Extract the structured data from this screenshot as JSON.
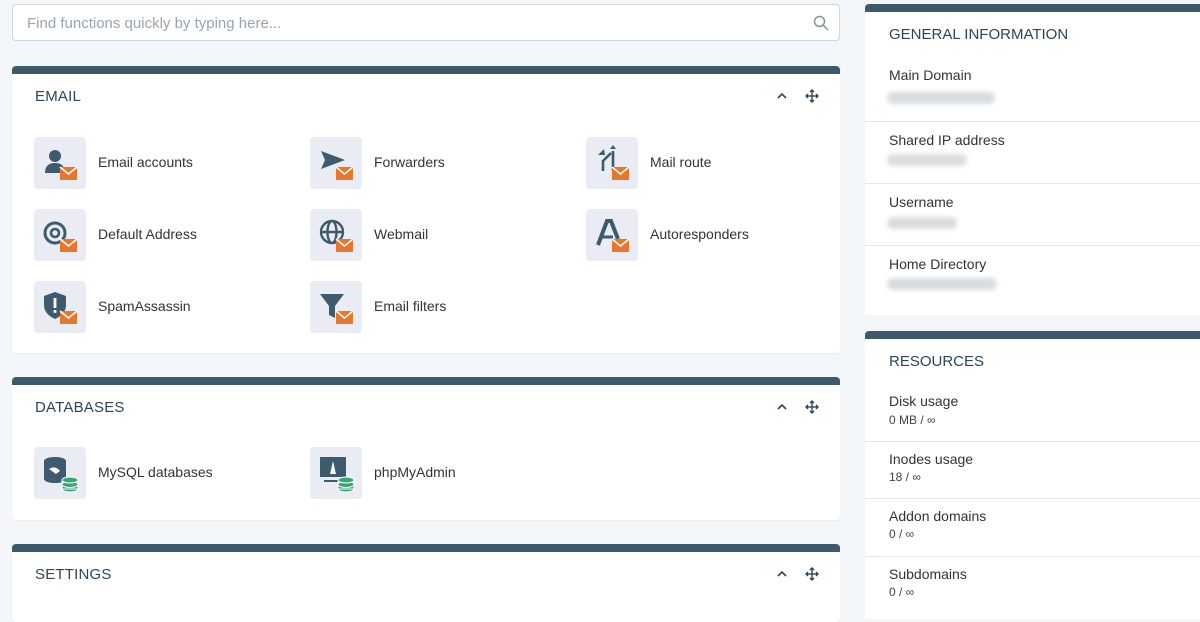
{
  "search": {
    "placeholder": "Find functions quickly by typing here..."
  },
  "colors": {
    "accent_bar": "#3d5a6c",
    "icon_dark": "#3e5a6e",
    "envelope_orange": "#e8772e",
    "db_green": "#3aa57a",
    "tile_bg": "#e9ecf3"
  },
  "email": {
    "title": "EMAIL",
    "items": [
      {
        "label": "Email accounts",
        "icon": "user-icon"
      },
      {
        "label": "Forwarders",
        "icon": "send-icon"
      },
      {
        "label": "Mail route",
        "icon": "route-arrows-icon"
      },
      {
        "label": "Default Address",
        "icon": "at-sign-icon"
      },
      {
        "label": "Webmail",
        "icon": "globe-icon"
      },
      {
        "label": "Autoresponders",
        "icon": "letter-a-icon"
      },
      {
        "label": "SpamAssassin",
        "icon": "shield-alert-icon"
      },
      {
        "label": "Email filters",
        "icon": "funnel-icon"
      }
    ]
  },
  "databases": {
    "title": "DATABASES",
    "items": [
      {
        "label": "MySQL databases",
        "icon": "mysql-database-icon"
      },
      {
        "label": "phpMyAdmin",
        "icon": "phpmyadmin-icon"
      }
    ]
  },
  "settings": {
    "title": "SETTINGS"
  },
  "general_info": {
    "title": "GENERAL INFORMATION",
    "rows": [
      {
        "label": "Main Domain"
      },
      {
        "label": "Shared IP address"
      },
      {
        "label": "Username"
      },
      {
        "label": "Home Directory"
      }
    ]
  },
  "resources": {
    "title": "RESOURCES",
    "rows": [
      {
        "label": "Disk usage",
        "value": "0 MB / ∞"
      },
      {
        "label": "Inodes usage",
        "value": "18 / ∞"
      },
      {
        "label": "Addon domains",
        "value": "0 / ∞"
      },
      {
        "label": "Subdomains",
        "value": "0 / ∞"
      }
    ]
  }
}
